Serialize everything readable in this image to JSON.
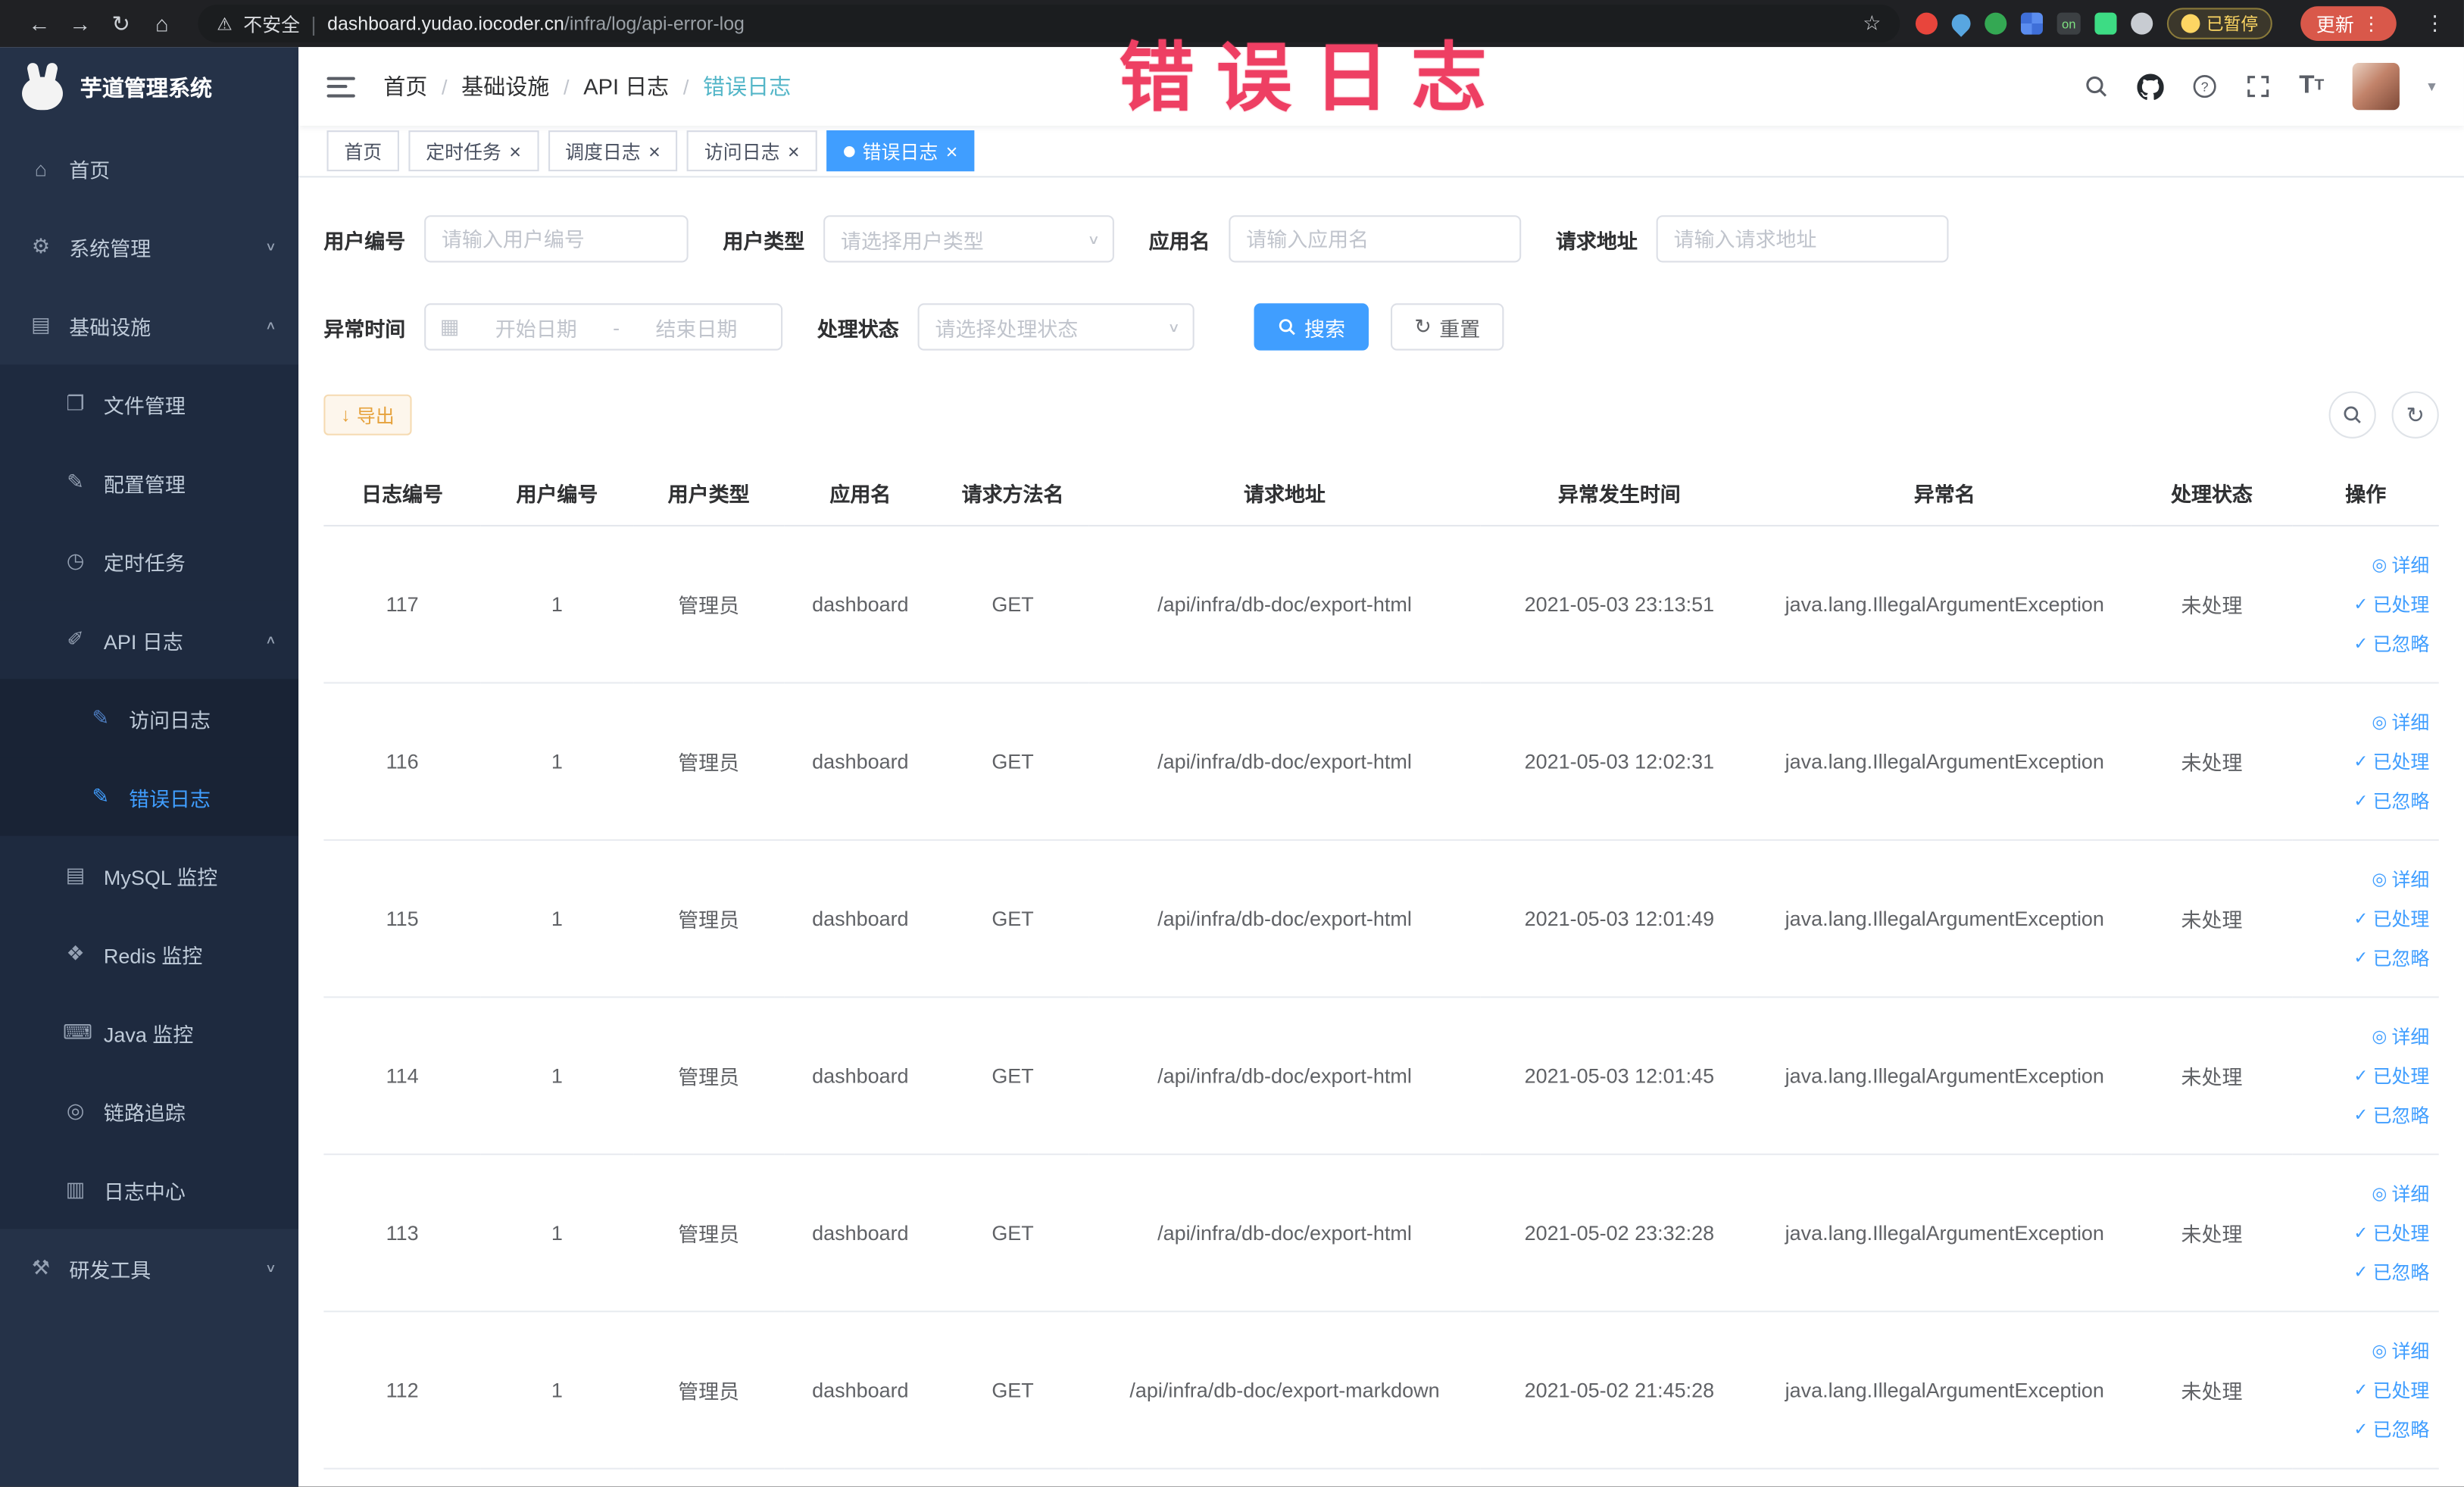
{
  "colors": {
    "primary": "#409eff",
    "annotation": "#ee3f63",
    "warning": "#e6a23c",
    "sidebar_bg": "#253248"
  },
  "browser": {
    "security_label": "不安全",
    "url_domain": "dashboard.yudao.iocoder.cn",
    "url_path": "/infra/log/api-error-log",
    "on_badge": "on",
    "paused_badge": "已暂停",
    "update_button": "更新"
  },
  "annotation": {
    "text": "错误日志"
  },
  "sidebar": {
    "logo_title": "芋道管理系统",
    "items": [
      {
        "key": "home",
        "label": "首页",
        "level": 1
      },
      {
        "key": "system",
        "label": "系统管理",
        "level": 1,
        "arrow": "down"
      },
      {
        "key": "infra",
        "label": "基础设施",
        "level": 1,
        "arrow": "up"
      },
      {
        "key": "file",
        "label": "文件管理",
        "level": 2
      },
      {
        "key": "config",
        "label": "配置管理",
        "level": 2
      },
      {
        "key": "job",
        "label": "定时任务",
        "level": 2
      },
      {
        "key": "api-log",
        "label": "API 日志",
        "level": 2,
        "arrow": "up"
      },
      {
        "key": "access-log",
        "label": "访问日志",
        "level": 3
      },
      {
        "key": "error-log",
        "label": "错误日志",
        "level": 3,
        "active": true
      },
      {
        "key": "mysql",
        "label": "MySQL 监控",
        "level": 2
      },
      {
        "key": "redis",
        "label": "Redis 监控",
        "level": 2
      },
      {
        "key": "java",
        "label": "Java 监控",
        "level": 2
      },
      {
        "key": "tracer",
        "label": "链路追踪",
        "level": 2
      },
      {
        "key": "log-center",
        "label": "日志中心",
        "level": 2
      },
      {
        "key": "dev-tools",
        "label": "研发工具",
        "level": 1,
        "arrow": "down"
      }
    ]
  },
  "breadcrumb": [
    "首页",
    "基础设施",
    "API 日志",
    "错误日志"
  ],
  "tabs": [
    {
      "key": "home",
      "label": "首页",
      "closable": false,
      "active": false
    },
    {
      "key": "job",
      "label": "定时任务",
      "closable": true,
      "active": false
    },
    {
      "key": "job-log",
      "label": "调度日志",
      "closable": true,
      "active": false
    },
    {
      "key": "access-log",
      "label": "访问日志",
      "closable": true,
      "active": false
    },
    {
      "key": "error-log",
      "label": "错误日志",
      "closable": true,
      "active": true
    }
  ],
  "filters": {
    "user_id_label": "用户编号",
    "user_id_placeholder": "请输入用户编号",
    "user_type_label": "用户类型",
    "user_type_placeholder": "请选择用户类型",
    "app_name_label": "应用名",
    "app_name_placeholder": "请输入应用名",
    "request_url_label": "请求地址",
    "request_url_placeholder": "请输入请求地址",
    "exception_time_label": "异常时间",
    "date_start_placeholder": "开始日期",
    "date_separator": "-",
    "date_end_placeholder": "结束日期",
    "process_status_label": "处理状态",
    "process_status_placeholder": "请选择处理状态",
    "search_button": "搜索",
    "reset_button": "重置"
  },
  "toolbar": {
    "export_button": "导出"
  },
  "table": {
    "columns": [
      "日志编号",
      "用户编号",
      "用户类型",
      "应用名",
      "请求方法名",
      "请求地址",
      "异常发生时间",
      "异常名",
      "处理状态",
      "操作"
    ],
    "row_actions": [
      "详细",
      "已处理",
      "已忽略"
    ],
    "rows": [
      {
        "log_id": "117",
        "user_id": "1",
        "user_type": "管理员",
        "app_name": "dashboard",
        "method": "GET",
        "request_url": "/api/infra/db-doc/export-html",
        "exception_time": "2021-05-03 23:13:51",
        "exception_name": "java.lang.IllegalArgumentException",
        "process_status": "未处理"
      },
      {
        "log_id": "116",
        "user_id": "1",
        "user_type": "管理员",
        "app_name": "dashboard",
        "method": "GET",
        "request_url": "/api/infra/db-doc/export-html",
        "exception_time": "2021-05-03 12:02:31",
        "exception_name": "java.lang.IllegalArgumentException",
        "process_status": "未处理"
      },
      {
        "log_id": "115",
        "user_id": "1",
        "user_type": "管理员",
        "app_name": "dashboard",
        "method": "GET",
        "request_url": "/api/infra/db-doc/export-html",
        "exception_time": "2021-05-03 12:01:49",
        "exception_name": "java.lang.IllegalArgumentException",
        "process_status": "未处理"
      },
      {
        "log_id": "114",
        "user_id": "1",
        "user_type": "管理员",
        "app_name": "dashboard",
        "method": "GET",
        "request_url": "/api/infra/db-doc/export-html",
        "exception_time": "2021-05-03 12:01:45",
        "exception_name": "java.lang.IllegalArgumentException",
        "process_status": "未处理"
      },
      {
        "log_id": "113",
        "user_id": "1",
        "user_type": "管理员",
        "app_name": "dashboard",
        "method": "GET",
        "request_url": "/api/infra/db-doc/export-html",
        "exception_time": "2021-05-02 23:32:28",
        "exception_name": "java.lang.IllegalArgumentException",
        "process_status": "未处理"
      },
      {
        "log_id": "112",
        "user_id": "1",
        "user_type": "管理员",
        "app_name": "dashboard",
        "method": "GET",
        "request_url": "/api/infra/db-doc/export-markdown",
        "exception_time": "2021-05-02 21:45:28",
        "exception_name": "java.lang.IllegalArgumentException",
        "process_status": "未处理"
      }
    ]
  }
}
